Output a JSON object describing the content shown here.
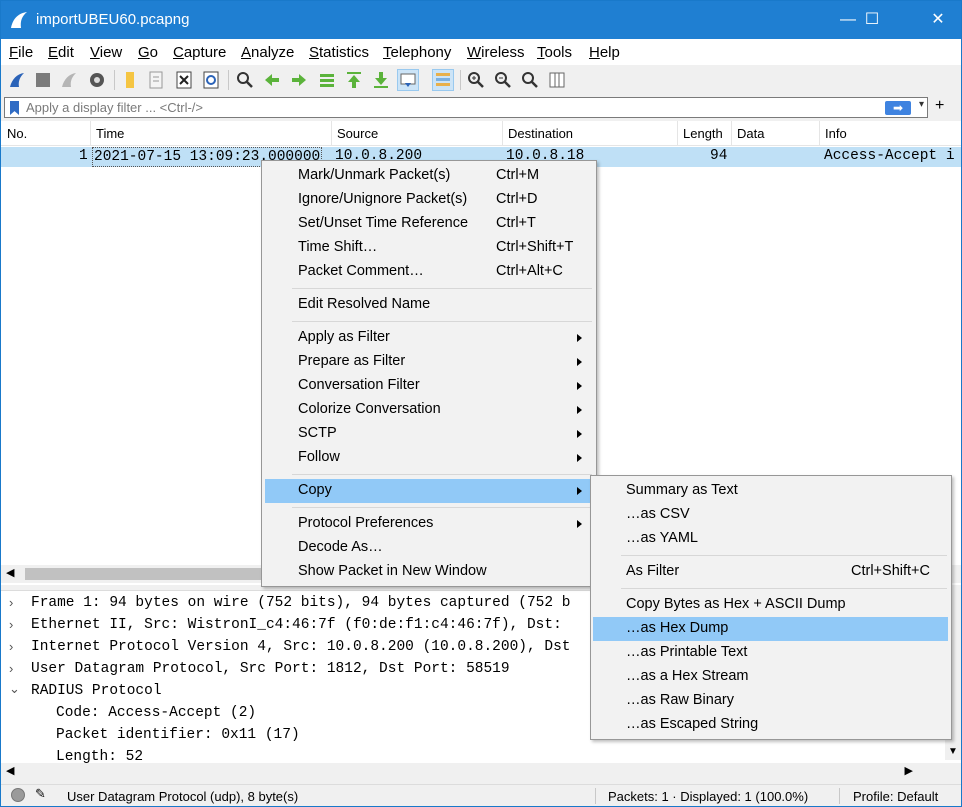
{
  "window": {
    "title": "importUBEU60.pcapng",
    "minimize": "—",
    "maximize": "☐",
    "close": "✕"
  },
  "menubar": [
    "File",
    "Edit",
    "View",
    "Go",
    "Capture",
    "Analyze",
    "Statistics",
    "Telephony",
    "Wireless",
    "Tools",
    "Help"
  ],
  "toolbar_icons": [
    "start-capture-icon",
    "stop-capture-icon",
    "restart-capture-icon",
    "capture-options-icon",
    "open-file-icon",
    "save-file-icon",
    "close-file-icon",
    "reload-file-icon",
    "find-packet-icon",
    "go-back-icon",
    "go-forward-icon",
    "go-to-packet-icon",
    "go-first-icon",
    "go-last-icon",
    "autoscroll-icon",
    "colorize-icon",
    "zoom-in-icon",
    "zoom-out-icon",
    "normal-size-icon",
    "resize-columns-icon"
  ],
  "filter": {
    "placeholder": "Apply a display filter ... <Ctrl-/>",
    "apply_arrow": "➡",
    "dropdown": "▾",
    "plus": "+"
  },
  "packet_list": {
    "columns": [
      "No.",
      "Time",
      "Source",
      "Destination",
      "Length",
      "Data",
      "Info"
    ],
    "rows": [
      {
        "no": "1",
        "time": "2021-07-15 13:09:23.000000",
        "source": "10.0.8.200",
        "destination": "10.0.8.18",
        "length": "94",
        "data": "",
        "info": "Access-Accept i"
      }
    ]
  },
  "details": {
    "lines": [
      {
        "expander": "›",
        "text": "Frame 1: 94 bytes on wire (752 bits), 94 bytes captured (752 b"
      },
      {
        "expander": "›",
        "text": "Ethernet II, Src: WistronI_c4:46:7f (f0:de:f1:c4:46:7f), Dst:"
      },
      {
        "expander": "›",
        "text": "Internet Protocol Version 4, Src: 10.0.8.200 (10.0.8.200), Dst"
      },
      {
        "expander": "›",
        "text": "User Datagram Protocol, Src Port: 1812, Dst Port: 58519"
      },
      {
        "expander": "⌄",
        "text": "RADIUS Protocol"
      },
      {
        "expander": "",
        "text": "Code: Access-Accept (2)"
      },
      {
        "expander": "",
        "text": "Packet identifier: 0x11 (17)"
      },
      {
        "expander": "",
        "text": "Length: 52"
      }
    ]
  },
  "status": {
    "field": "User Datagram Protocol (udp), 8 byte(s)",
    "packets": "Packets: 1 · Displayed: 1 (100.0%)",
    "profile": "Profile: Default"
  },
  "context_menu": {
    "items": [
      {
        "label": "Mark/Unmark Packet(s)",
        "shortcut": "Ctrl+M",
        "submenu": false
      },
      {
        "label": "Ignore/Unignore Packet(s)",
        "shortcut": "Ctrl+D",
        "submenu": false
      },
      {
        "label": "Set/Unset Time Reference",
        "shortcut": "Ctrl+T",
        "submenu": false
      },
      {
        "label": "Time Shift…",
        "shortcut": "Ctrl+Shift+T",
        "submenu": false
      },
      {
        "label": "Packet Comment…",
        "shortcut": "Ctrl+Alt+C",
        "submenu": false
      },
      {
        "label": "Edit Resolved Name",
        "shortcut": "",
        "submenu": false
      },
      {
        "label": "Apply as Filter",
        "shortcut": "",
        "submenu": true
      },
      {
        "label": "Prepare as Filter",
        "shortcut": "",
        "submenu": true
      },
      {
        "label": "Conversation Filter",
        "shortcut": "",
        "submenu": true
      },
      {
        "label": "Colorize Conversation",
        "shortcut": "",
        "submenu": true
      },
      {
        "label": "SCTP",
        "shortcut": "",
        "submenu": true
      },
      {
        "label": "Follow",
        "shortcut": "",
        "submenu": true
      },
      {
        "label": "Copy",
        "shortcut": "",
        "submenu": true,
        "highlighted": true
      },
      {
        "label": "Protocol Preferences",
        "shortcut": "",
        "submenu": true
      },
      {
        "label": "Decode As…",
        "shortcut": "",
        "submenu": false
      },
      {
        "label": "Show Packet in New Window",
        "shortcut": "",
        "submenu": false
      }
    ]
  },
  "copy_submenu": {
    "items": [
      {
        "label": "Summary as Text",
        "shortcut": ""
      },
      {
        "label": "…as CSV",
        "shortcut": ""
      },
      {
        "label": "…as YAML",
        "shortcut": ""
      },
      {
        "label": "As Filter",
        "shortcut": "Ctrl+Shift+C"
      },
      {
        "label": "Copy Bytes as Hex + ASCII Dump",
        "shortcut": ""
      },
      {
        "label": "…as Hex Dump",
        "shortcut": "",
        "highlighted": true
      },
      {
        "label": "…as Printable Text",
        "shortcut": ""
      },
      {
        "label": "…as a Hex Stream",
        "shortcut": ""
      },
      {
        "label": "…as Raw Binary",
        "shortcut": ""
      },
      {
        "label": "…as Escaped String",
        "shortcut": ""
      }
    ]
  },
  "colors": {
    "titlebar": "#1f7fd2",
    "selection": "#bfe0f6",
    "menu_highlight": "#91c9f7"
  }
}
